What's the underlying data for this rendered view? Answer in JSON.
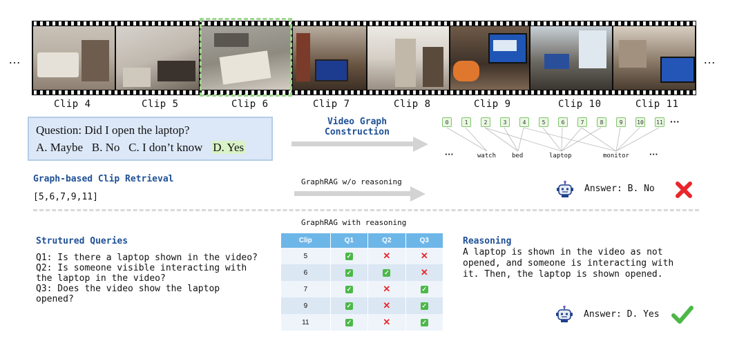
{
  "filmstrip": {
    "ellipsis_left": "…",
    "ellipsis_right": "…",
    "clips": [
      "Clip 4",
      "Clip 5",
      "Clip 6",
      "Clip 7",
      "Clip 8",
      "Clip 9",
      "Clip 10",
      "Clip 11"
    ]
  },
  "question": {
    "text": "Question: Did I open the laptop?",
    "options": [
      "A. Maybe",
      "B. No",
      "C. I don’t know",
      "D. Yes"
    ]
  },
  "graph": {
    "title": "Video Graph Construction",
    "title_line1": "Video Graph",
    "title_line2": "Construction",
    "nodes": [
      "0",
      "1",
      "2",
      "3",
      "4",
      "5",
      "6",
      "7",
      "8",
      "9",
      "10",
      "11"
    ],
    "nodes_ellipsis": "···",
    "entities": [
      "watch",
      "bed",
      "laptop",
      "monitor"
    ],
    "entities_ellipsis_left": "···",
    "entities_ellipsis_right": "···"
  },
  "retrieval": {
    "title": "Graph-based Clip Retrieval",
    "result": "[5,6,7,9,11]"
  },
  "no_reasoning": {
    "label": "GraphRAG w/o reasoning",
    "answer": "Answer: B. No"
  },
  "with_reasoning": {
    "label": "GraphRAG with reasoning"
  },
  "queries": {
    "title": "Strutured Queries",
    "lines": [
      "Q1: Is there a laptop shown in the video?",
      "Q2: Is someone visible interacting with",
      "the laptop in the video?",
      "Q3: Does the video show the laptop",
      "opened?"
    ]
  },
  "table": {
    "headers": [
      "Clip",
      "Q1",
      "Q2",
      "Q3"
    ],
    "rows": [
      {
        "clip": "5",
        "q": [
          "yes",
          "no",
          "no"
        ]
      },
      {
        "clip": "6",
        "q": [
          "yes",
          "yes",
          "no"
        ]
      },
      {
        "clip": "7",
        "q": [
          "yes",
          "no",
          "yes"
        ]
      },
      {
        "clip": "9",
        "q": [
          "yes",
          "no",
          "yes"
        ]
      },
      {
        "clip": "11",
        "q": [
          "yes",
          "no",
          "yes"
        ]
      }
    ]
  },
  "reasoning": {
    "title": "Reasoning",
    "lines": [
      "A laptop is shown in the video as not",
      "opened, and someone is interacting with",
      "it. Then, the laptop is shown opened."
    ],
    "answer": "Answer: D. Yes"
  },
  "icons": {
    "robot": "robot-icon",
    "wrong": "cross-mark-icon",
    "correct": "check-mark-icon",
    "table_yes": "check-box-icon",
    "table_no": "cross-icon"
  },
  "colors": {
    "section_title": "#1f5096",
    "highlight": "#9bd58a",
    "question_bg": "#dce8f7",
    "table_header": "#6db6e8",
    "wrong": "#e8262b",
    "correct": "#4cb848"
  }
}
